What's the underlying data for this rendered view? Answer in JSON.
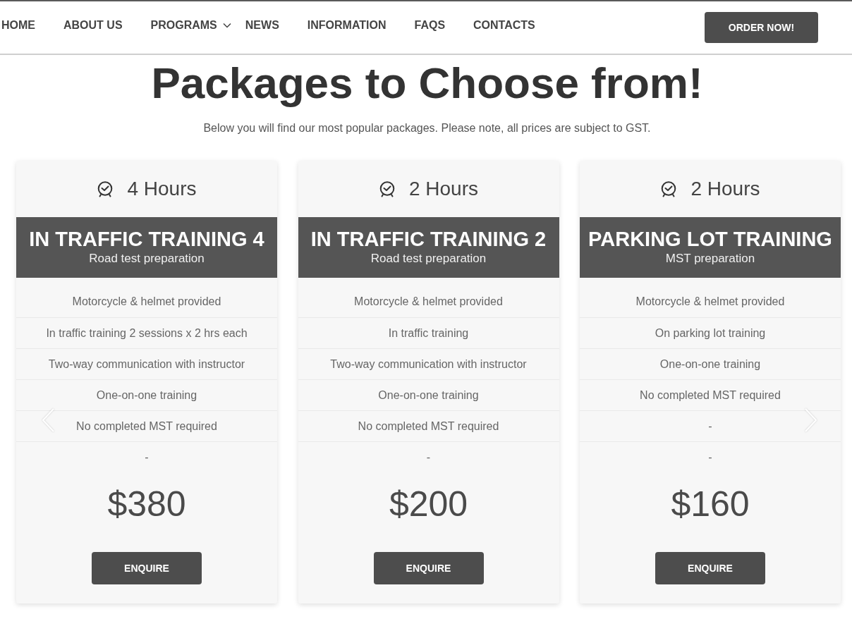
{
  "nav": {
    "items": [
      {
        "label": "HOME",
        "dropdown": false
      },
      {
        "label": "ABOUT US",
        "dropdown": false
      },
      {
        "label": "PROGRAMS",
        "dropdown": true
      },
      {
        "label": "NEWS",
        "dropdown": false
      },
      {
        "label": "INFORMATION",
        "dropdown": false
      },
      {
        "label": "FAQS",
        "dropdown": false
      },
      {
        "label": "CONTACTS",
        "dropdown": false
      }
    ],
    "order_button": "ORDER NOW!"
  },
  "heading": "Packages to Choose from!",
  "subheading": "Below you will find our most popular packages. Please note, all prices are subject to GST.",
  "packages": [
    {
      "duration": "4 Hours",
      "title": "IN TRAFFIC TRAINING 4",
      "subtitle": "Road test preparation",
      "features": [
        "Motorcycle & helmet provided",
        "In traffic training 2 sessions x 2 hrs each",
        "Two-way communication with instructor",
        "One-on-one training",
        "No completed MST required",
        "-"
      ],
      "price": "$380",
      "button": "ENQUIRE"
    },
    {
      "duration": "2 Hours",
      "title": "IN TRAFFIC TRAINING 2",
      "subtitle": "Road test preparation",
      "features": [
        "Motorcycle & helmet provided",
        "In traffic training",
        "Two-way communication with instructor",
        "One-on-one training",
        "No completed MST required",
        "-"
      ],
      "price": "$200",
      "button": "ENQUIRE"
    },
    {
      "duration": "2 Hours",
      "title": "PARKING LOT TRAINING",
      "subtitle": "MST preparation",
      "features": [
        "Motorcycle & helmet provided",
        "On parking lot training",
        "One-on-one training",
        "No completed MST required",
        "-",
        "-"
      ],
      "price": "$160",
      "button": "ENQUIRE"
    }
  ]
}
